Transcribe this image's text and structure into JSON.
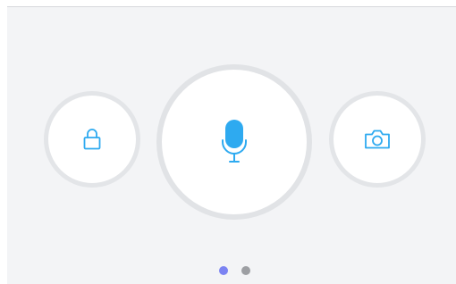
{
  "buttons": [
    {
      "name": "lock-button",
      "icon": "lock-icon"
    },
    {
      "name": "microphone-button",
      "icon": "microphone-icon"
    },
    {
      "name": "camera-button",
      "icon": "camera-icon"
    }
  ],
  "pager": {
    "page_count": 2,
    "current_page": 1
  },
  "colors": {
    "accent": "#2eaaf0",
    "dot_active": "#7b83f2",
    "dot_inactive": "#9d9fa3",
    "background": "#f3f4f6",
    "ring": "#e3e5e8"
  }
}
